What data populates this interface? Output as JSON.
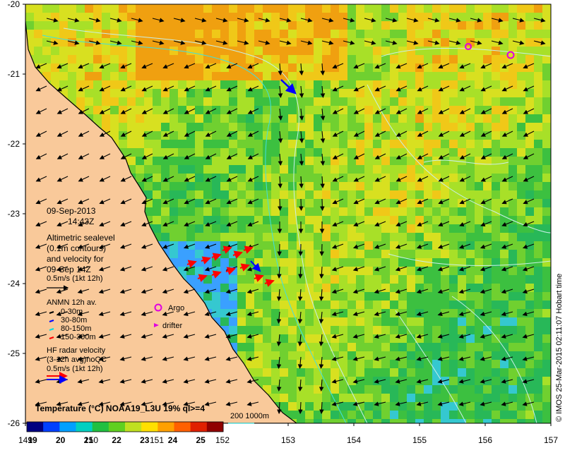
{
  "map": {
    "lat_ticks": [
      "-20",
      "-21",
      "-22",
      "-23",
      "-24",
      "-25",
      "-26"
    ],
    "lon_ticks": [
      "149",
      "150",
      "151",
      "152",
      "153",
      "154",
      "155",
      "156",
      "157"
    ],
    "lat_range": [
      -26,
      -20
    ],
    "lon_range": [
      149,
      157
    ]
  },
  "annotation": {
    "date": "09-Sep-2013",
    "time": "14:43Z",
    "alt_line1": "Altimetric sealevel",
    "alt_line2": "(0.1m contours)",
    "alt_line3": "and velocity for",
    "alt_line4": "09-Sep 14Z",
    "alt_scale": "0.5m/s (1kt 12h)",
    "anmn_title": "ANMN 12h av.",
    "anmn_items": [
      "0-30m",
      "30-80m",
      "80-150m",
      "150-300m"
    ],
    "anmn_colors": [
      "#000000",
      "#0000ff",
      "#00e0e0",
      "#ff0000"
    ],
    "argo_label": "Argo",
    "drifter_label": "drifter",
    "hf_line1": "HF radar velocity",
    "hf_line2": "(3-12h avg)noQC",
    "hf_scale": "0.5m/s (1kt 12h)"
  },
  "colorbar": {
    "title": "Temperature (°C) NOAA19_L3U 19% ql>=4",
    "ticks": [
      "19",
      "20",
      "21",
      "22",
      "23",
      "24",
      "25"
    ],
    "colors": [
      "#000080",
      "#0040ff",
      "#00a0ff",
      "#00d0c0",
      "#20c040",
      "#60d020",
      "#c0e020",
      "#ffe000",
      "#ffa000",
      "#ff6000",
      "#e02000",
      "#900000"
    ]
  },
  "contour_legend": {
    "label": "200  1000m",
    "color": "#40e0e0"
  },
  "credit": "© IMOS 25-Mar-2015 02:11:07 Hobart time",
  "colors": {
    "land": "#f9c99a",
    "coast": "#000000",
    "argo": "#e000e0",
    "drifter": "#e000e0"
  }
}
